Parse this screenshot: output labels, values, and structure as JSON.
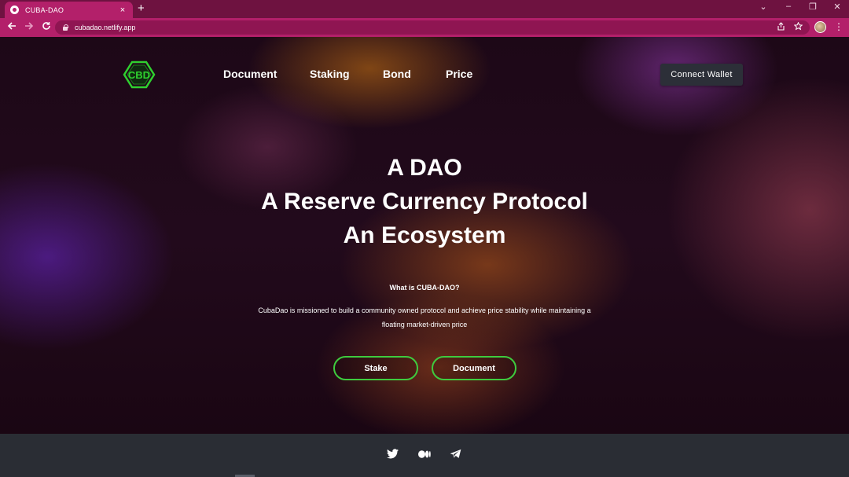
{
  "browser": {
    "tab_title": "CUBA-DAO",
    "tab_close": "×",
    "new_tab": "+",
    "url": "cubadao.netlify.app",
    "window_controls": [
      "⌄",
      "–",
      "❐",
      "✕"
    ],
    "icons": [
      "back-arrow-icon",
      "forward-arrow-icon",
      "reload-icon",
      "lock-icon",
      "share-icon",
      "star-icon",
      "profile-avatar",
      "more-menu-icon"
    ]
  },
  "header": {
    "logo_text": "CBD",
    "nav": [
      "Document",
      "Staking",
      "Bond",
      "Price"
    ],
    "connect_wallet": "Connect Wallet"
  },
  "hero": {
    "lines": [
      "A DAO",
      "A Reserve Currency Protocol",
      "An Ecosystem"
    ],
    "subheading": "What is CUBA-DAO?",
    "description": "CubaDao is missioned to build a community owned protocol and achieve price stability while maintaining a floating market-driven price",
    "buttons": [
      "Stake",
      "Document"
    ]
  },
  "footer": {
    "social_icons": [
      "twitter-icon",
      "medium-icon",
      "telegram-icon"
    ]
  },
  "colors": {
    "tab_bar": "#6e1240",
    "address_bar": "#b3206a",
    "accent_green": "#3ecb3e",
    "button_dark": "#2c2f38",
    "footer_bg": "#2a2d34"
  }
}
